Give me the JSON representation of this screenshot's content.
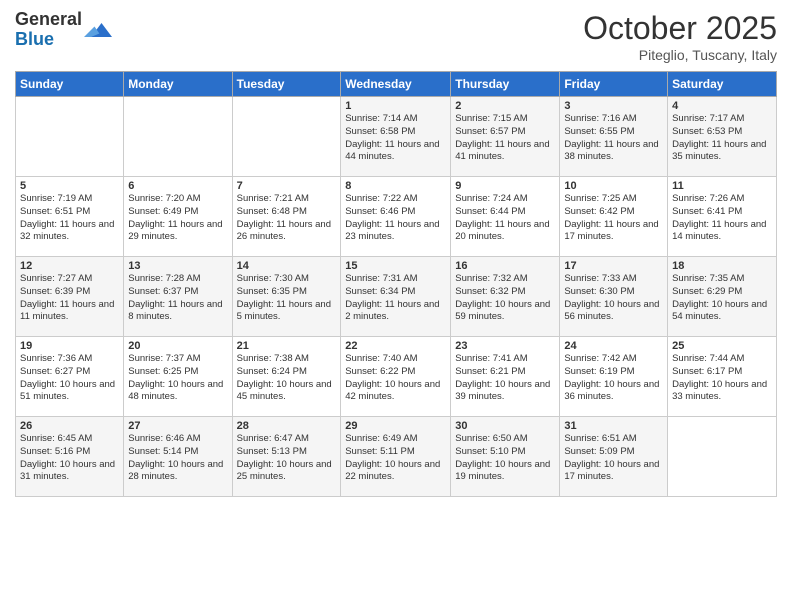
{
  "header": {
    "logo_line1": "General",
    "logo_line2": "Blue",
    "month": "October 2025",
    "location": "Piteglio, Tuscany, Italy"
  },
  "days_of_week": [
    "Sunday",
    "Monday",
    "Tuesday",
    "Wednesday",
    "Thursday",
    "Friday",
    "Saturday"
  ],
  "weeks": [
    [
      {
        "day": "",
        "info": ""
      },
      {
        "day": "",
        "info": ""
      },
      {
        "day": "",
        "info": ""
      },
      {
        "day": "1",
        "info": "Sunrise: 7:14 AM\nSunset: 6:58 PM\nDaylight: 11 hours and 44 minutes."
      },
      {
        "day": "2",
        "info": "Sunrise: 7:15 AM\nSunset: 6:57 PM\nDaylight: 11 hours and 41 minutes."
      },
      {
        "day": "3",
        "info": "Sunrise: 7:16 AM\nSunset: 6:55 PM\nDaylight: 11 hours and 38 minutes."
      },
      {
        "day": "4",
        "info": "Sunrise: 7:17 AM\nSunset: 6:53 PM\nDaylight: 11 hours and 35 minutes."
      }
    ],
    [
      {
        "day": "5",
        "info": "Sunrise: 7:19 AM\nSunset: 6:51 PM\nDaylight: 11 hours and 32 minutes."
      },
      {
        "day": "6",
        "info": "Sunrise: 7:20 AM\nSunset: 6:49 PM\nDaylight: 11 hours and 29 minutes."
      },
      {
        "day": "7",
        "info": "Sunrise: 7:21 AM\nSunset: 6:48 PM\nDaylight: 11 hours and 26 minutes."
      },
      {
        "day": "8",
        "info": "Sunrise: 7:22 AM\nSunset: 6:46 PM\nDaylight: 11 hours and 23 minutes."
      },
      {
        "day": "9",
        "info": "Sunrise: 7:24 AM\nSunset: 6:44 PM\nDaylight: 11 hours and 20 minutes."
      },
      {
        "day": "10",
        "info": "Sunrise: 7:25 AM\nSunset: 6:42 PM\nDaylight: 11 hours and 17 minutes."
      },
      {
        "day": "11",
        "info": "Sunrise: 7:26 AM\nSunset: 6:41 PM\nDaylight: 11 hours and 14 minutes."
      }
    ],
    [
      {
        "day": "12",
        "info": "Sunrise: 7:27 AM\nSunset: 6:39 PM\nDaylight: 11 hours and 11 minutes."
      },
      {
        "day": "13",
        "info": "Sunrise: 7:28 AM\nSunset: 6:37 PM\nDaylight: 11 hours and 8 minutes."
      },
      {
        "day": "14",
        "info": "Sunrise: 7:30 AM\nSunset: 6:35 PM\nDaylight: 11 hours and 5 minutes."
      },
      {
        "day": "15",
        "info": "Sunrise: 7:31 AM\nSunset: 6:34 PM\nDaylight: 11 hours and 2 minutes."
      },
      {
        "day": "16",
        "info": "Sunrise: 7:32 AM\nSunset: 6:32 PM\nDaylight: 10 hours and 59 minutes."
      },
      {
        "day": "17",
        "info": "Sunrise: 7:33 AM\nSunset: 6:30 PM\nDaylight: 10 hours and 56 minutes."
      },
      {
        "day": "18",
        "info": "Sunrise: 7:35 AM\nSunset: 6:29 PM\nDaylight: 10 hours and 54 minutes."
      }
    ],
    [
      {
        "day": "19",
        "info": "Sunrise: 7:36 AM\nSunset: 6:27 PM\nDaylight: 10 hours and 51 minutes."
      },
      {
        "day": "20",
        "info": "Sunrise: 7:37 AM\nSunset: 6:25 PM\nDaylight: 10 hours and 48 minutes."
      },
      {
        "day": "21",
        "info": "Sunrise: 7:38 AM\nSunset: 6:24 PM\nDaylight: 10 hours and 45 minutes."
      },
      {
        "day": "22",
        "info": "Sunrise: 7:40 AM\nSunset: 6:22 PM\nDaylight: 10 hours and 42 minutes."
      },
      {
        "day": "23",
        "info": "Sunrise: 7:41 AM\nSunset: 6:21 PM\nDaylight: 10 hours and 39 minutes."
      },
      {
        "day": "24",
        "info": "Sunrise: 7:42 AM\nSunset: 6:19 PM\nDaylight: 10 hours and 36 minutes."
      },
      {
        "day": "25",
        "info": "Sunrise: 7:44 AM\nSunset: 6:17 PM\nDaylight: 10 hours and 33 minutes."
      }
    ],
    [
      {
        "day": "26",
        "info": "Sunrise: 6:45 AM\nSunset: 5:16 PM\nDaylight: 10 hours and 31 minutes."
      },
      {
        "day": "27",
        "info": "Sunrise: 6:46 AM\nSunset: 5:14 PM\nDaylight: 10 hours and 28 minutes."
      },
      {
        "day": "28",
        "info": "Sunrise: 6:47 AM\nSunset: 5:13 PM\nDaylight: 10 hours and 25 minutes."
      },
      {
        "day": "29",
        "info": "Sunrise: 6:49 AM\nSunset: 5:11 PM\nDaylight: 10 hours and 22 minutes."
      },
      {
        "day": "30",
        "info": "Sunrise: 6:50 AM\nSunset: 5:10 PM\nDaylight: 10 hours and 19 minutes."
      },
      {
        "day": "31",
        "info": "Sunrise: 6:51 AM\nSunset: 5:09 PM\nDaylight: 10 hours and 17 minutes."
      },
      {
        "day": "",
        "info": ""
      }
    ]
  ]
}
